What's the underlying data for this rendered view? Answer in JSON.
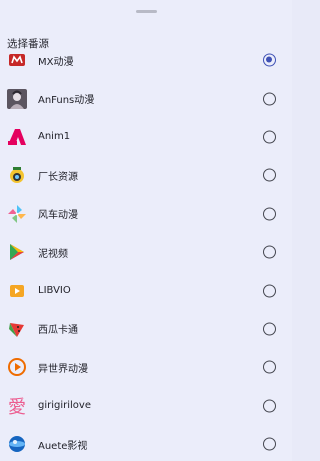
{
  "sheet": {
    "title": "选择番源"
  },
  "sources": [
    {
      "label": "MX动漫",
      "icon": "mx-icon",
      "selected": true
    },
    {
      "label": "AnFuns动漫",
      "icon": "anfuns-icon",
      "selected": false
    },
    {
      "label": "Anim1",
      "icon": "anim1-icon",
      "selected": false
    },
    {
      "label": "厂长资源",
      "icon": "changzhang-icon",
      "selected": false
    },
    {
      "label": "风车动漫",
      "icon": "pinwheel-icon",
      "selected": false
    },
    {
      "label": "泥视频",
      "icon": "play-icon",
      "selected": false
    },
    {
      "label": "LIBVIO",
      "icon": "libvio-icon",
      "selected": false
    },
    {
      "label": "西瓜卡通",
      "icon": "watermelon-icon",
      "selected": false
    },
    {
      "label": "异世界动漫",
      "icon": "isekai-icon",
      "selected": false
    },
    {
      "label": "girigirilove",
      "icon": "ai-love-icon",
      "icon_text": "愛",
      "selected": false
    },
    {
      "label": "Auete影视",
      "icon": "auete-icon",
      "selected": false
    }
  ],
  "colors": {
    "accent": "#3f51b5",
    "background": "#ebedfa"
  }
}
